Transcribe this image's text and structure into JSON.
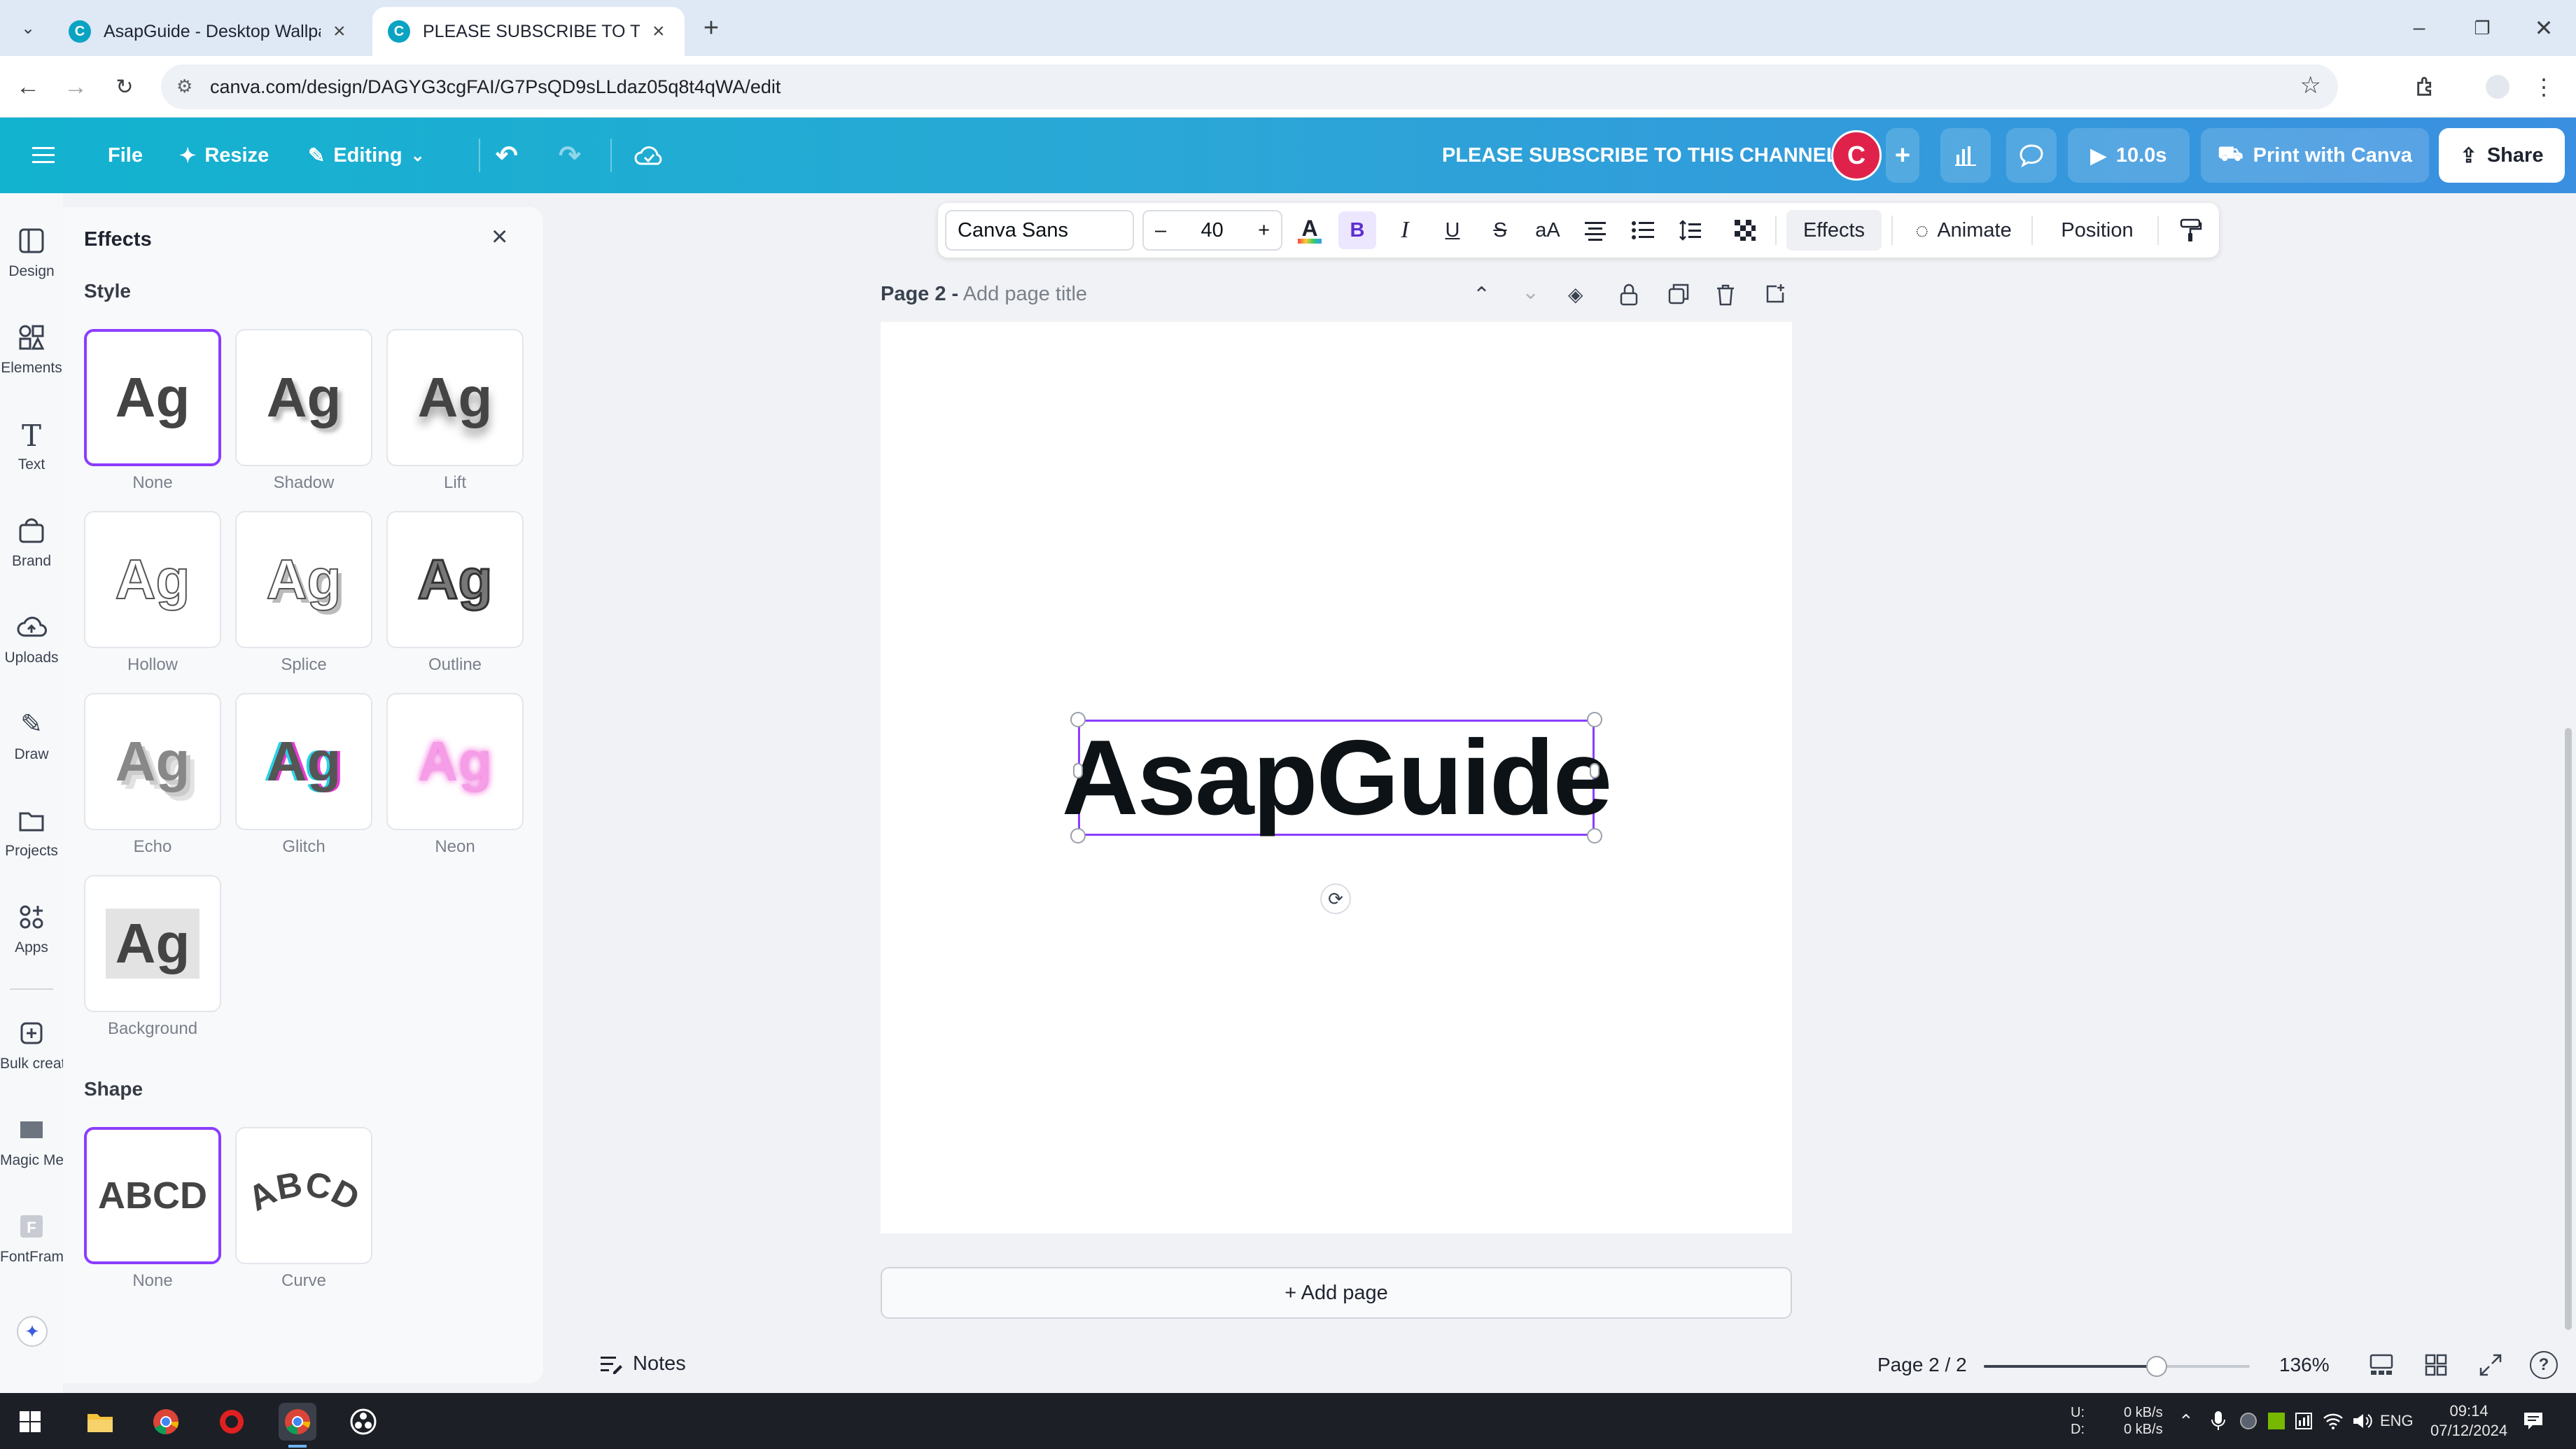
{
  "browser": {
    "tabs": [
      {
        "title": "AsapGuide - Desktop Wallpape",
        "active": false
      },
      {
        "title": "PLEASE SUBSCRIBE TO THIS CH",
        "active": true
      }
    ],
    "url": "canva.com/design/DAGYG3cgFAI/G7PsQD9sLLdaz05q8t4qWA/edit",
    "window_controls": [
      "minimize",
      "restore",
      "close"
    ]
  },
  "topbar": {
    "file": "File",
    "resize": "Resize",
    "editing": "Editing",
    "title": "PLEASE SUBSCRIBE TO THIS CHANNEL",
    "avatar_letter": "C",
    "play_duration": "10.0s",
    "print": "Print with Canva",
    "share": "Share"
  },
  "rail": [
    "Design",
    "Elements",
    "Text",
    "Brand",
    "Uploads",
    "Draw",
    "Projects",
    "Apps",
    "Bulk create",
    "Magic Media",
    "FontFrame"
  ],
  "panel": {
    "title": "Effects",
    "style_section": "Style",
    "styles": [
      {
        "label": "None",
        "sample": "Ag"
      },
      {
        "label": "Shadow",
        "sample": "Ag"
      },
      {
        "label": "Lift",
        "sample": "Ag"
      },
      {
        "label": "Hollow",
        "sample": "Ag"
      },
      {
        "label": "Splice",
        "sample": "Ag"
      },
      {
        "label": "Outline",
        "sample": "Ag"
      },
      {
        "label": "Echo",
        "sample": "Ag"
      },
      {
        "label": "Glitch",
        "sample": "Ag"
      },
      {
        "label": "Neon",
        "sample": "Ag"
      },
      {
        "label": "Background",
        "sample": "Ag"
      }
    ],
    "shape_section": "Shape",
    "shapes": [
      {
        "label": "None",
        "sample": "ABCD"
      },
      {
        "label": "Curve",
        "sample": "ABCD"
      }
    ]
  },
  "toolbar": {
    "font": "Canva Sans",
    "size": "40",
    "minus": "–",
    "plus": "+",
    "bold": "B",
    "italic": "I",
    "underline": "U",
    "strike": "S",
    "case": "aA",
    "effects": "Effects",
    "animate": "Animate",
    "position": "Position"
  },
  "canvas": {
    "page_label": "Page 2 -",
    "page_title_placeholder": "Add page title",
    "text": "AsapGuide",
    "add_page": "+ Add page"
  },
  "footer": {
    "notes": "Notes",
    "page_indicator": "Page 2 / 2",
    "zoom": "136%",
    "zoom_fraction": 0.65
  },
  "taskbar": {
    "net_up_label": "U:",
    "net_down_label": "D:",
    "net_up": "0 kB/s",
    "net_down": "0 kB/s",
    "lang": "ENG",
    "time": "09:14",
    "date": "07/12/2024"
  },
  "colors": {
    "canva_accent": "#12b3cf",
    "selection": "#8b3dff",
    "avatar": "#e0224a"
  }
}
